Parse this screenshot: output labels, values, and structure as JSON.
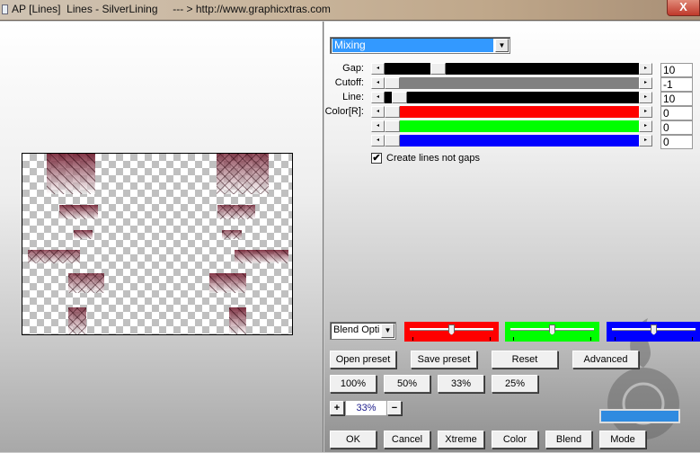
{
  "window": {
    "title": "AP [Lines]  Lines - SilverLining     --- > http://www.graphicxtras.com",
    "close_label": "X"
  },
  "mode_select": {
    "value": "Mixing"
  },
  "sliders": [
    {
      "label": "Gap:",
      "value": "10",
      "color": "#000000",
      "position": 0.19
    },
    {
      "label": "Cutoff:",
      "value": "-1",
      "color": "#808080",
      "position": 0.0
    },
    {
      "label": "Line:",
      "value": "10",
      "color": "#000000",
      "position": 0.03
    },
    {
      "label": "Color[R]:",
      "value": "0",
      "color": "#ff0000",
      "position": 0.0
    },
    {
      "label": "",
      "value": "0",
      "color": "#00ff00",
      "position": 0.0
    },
    {
      "label": "",
      "value": "0",
      "color": "#0000ff",
      "position": 0.0
    }
  ],
  "checkbox": {
    "label": "Create lines not gaps",
    "checked": true
  },
  "blend_select": {
    "value": "Blend Opti"
  },
  "color_sliders": [
    {
      "color": "#ff0000",
      "position": 0.5
    },
    {
      "color": "#00ff00",
      "position": 0.5
    },
    {
      "color": "#0000ff",
      "position": 0.5
    }
  ],
  "preset_buttons": [
    "Open preset",
    "Save preset",
    "Reset",
    "Advanced"
  ],
  "zoom_buttons": [
    "100%",
    "50%",
    "33%",
    "25%"
  ],
  "zoom": {
    "plus": "+",
    "value": "33%",
    "minus": "−"
  },
  "action_buttons": [
    "OK",
    "Cancel",
    "Xtreme",
    "Color",
    "Blend",
    "Mode"
  ]
}
